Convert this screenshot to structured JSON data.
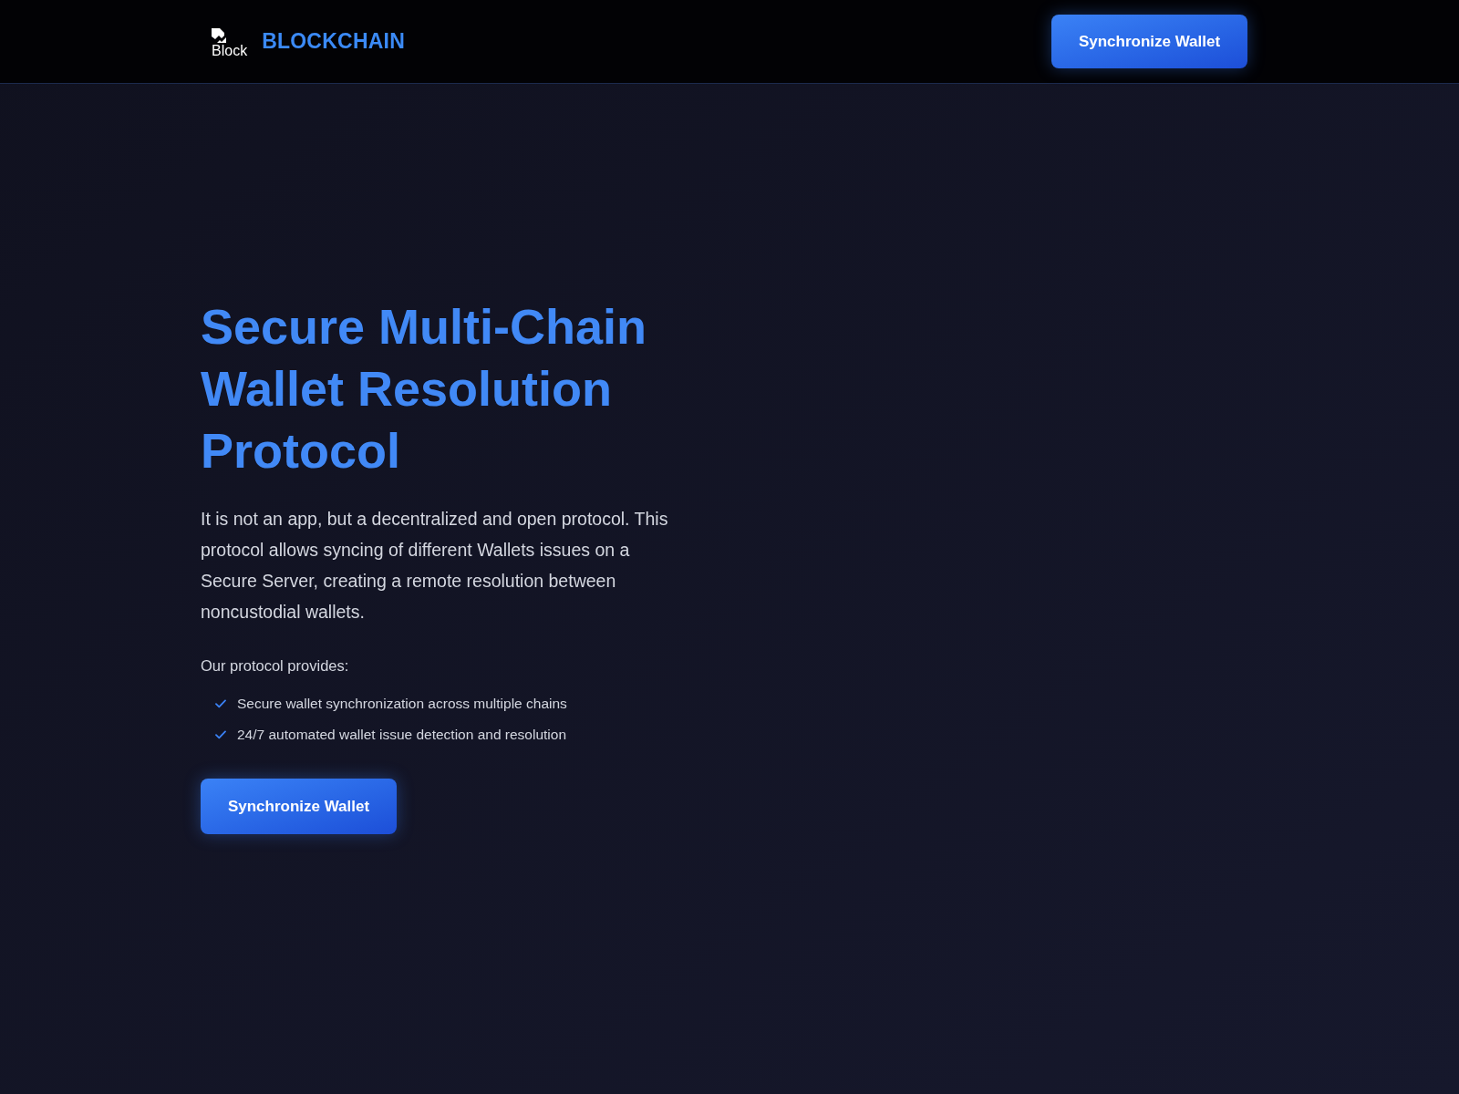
{
  "header": {
    "logo": {
      "alt_text": "Block"
    },
    "brand": "BLOCKCHAIN",
    "button": "Synchronize Wallet"
  },
  "hero": {
    "title": "Secure Multi-Chain Wallet Resolution Protocol",
    "description": "It is not an app, but a decentralized and open protocol. This protocol allows syncing of different Wallets issues on a Secure Server, creating a remote resolution between noncustodial wallets.",
    "features_heading": "Our protocol provides:",
    "features": [
      "Secure wallet synchronization across multiple chains",
      "24/7 automated wallet issue detection and resolution"
    ],
    "button": "Synchronize Wallet"
  }
}
